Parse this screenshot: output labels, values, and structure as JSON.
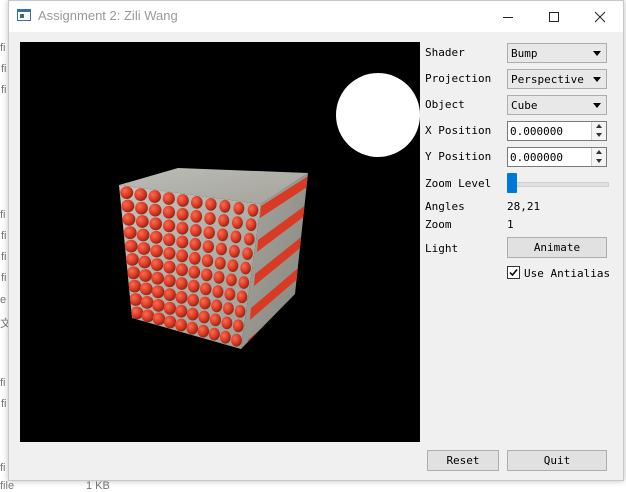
{
  "window": {
    "title": "Assignment 2: Zili Wang"
  },
  "background": {
    "fragments": [
      "fi",
      "fi",
      "fi",
      "fi",
      "fi",
      "fi",
      "fi",
      "e",
      "文",
      "fi",
      "fi",
      "fi",
      "file",
      "1 KB"
    ]
  },
  "controls": {
    "shader": {
      "label": "Shader",
      "value": "Bump"
    },
    "projection": {
      "label": "Projection",
      "value": "Perspective"
    },
    "object": {
      "label": "Object",
      "value": "Cube"
    },
    "x_position": {
      "label": "X Position",
      "value": "0.000000"
    },
    "y_position": {
      "label": "Y Position",
      "value": "0.000000"
    },
    "zoom_level": {
      "label": "Zoom Level",
      "slider_fraction": 0.0
    },
    "angles": {
      "label": "Angles",
      "value": "28,21"
    },
    "zoom": {
      "label": "Zoom",
      "value": "1"
    },
    "light": {
      "label": "Light",
      "button": "Animate"
    },
    "antialias": {
      "label": "Use Antialias",
      "checked": true
    },
    "reset": "Reset",
    "quit": "Quit"
  },
  "scene": {
    "background": "#000000",
    "cube_color": "#a9a9a2",
    "dot_color": "#e0402a",
    "light_color": "#ffffff"
  }
}
